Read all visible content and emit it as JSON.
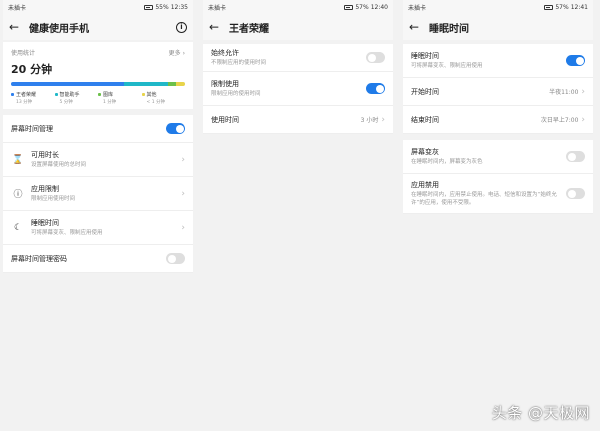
{
  "status": {
    "carrier": "未插卡",
    "s1": {
      "battery": "55%",
      "time": "12:35"
    },
    "s2": {
      "battery": "57%",
      "time": "12:40"
    },
    "s3": {
      "battery": "57%",
      "time": "12:41"
    }
  },
  "screen1": {
    "title": "健康使用手机",
    "usage": {
      "label": "使用统计",
      "more": "更多",
      "total": "20 分钟",
      "legend": [
        {
          "name": "王者荣耀",
          "value": "13 分钟",
          "minutes": 13,
          "color": "#2f80ed"
        },
        {
          "name": "智能助手",
          "value": "5 分钟",
          "minutes": 5,
          "color": "#20b8c8"
        },
        {
          "name": "图库",
          "value": "1 分钟",
          "minutes": 1,
          "color": "#6cc04a"
        },
        {
          "name": "其他",
          "value": "< 1 分钟",
          "minutes": 1,
          "color": "#e8d44a"
        }
      ]
    },
    "manage_label": "屏幕时间管理",
    "items": [
      {
        "title": "可用时长",
        "subtitle": "设置屏幕使用的总时间"
      },
      {
        "title": "应用限制",
        "subtitle": "限制应用使用时间"
      },
      {
        "title": "睡眠时间",
        "subtitle": "可将屏幕变灰、限制应用使用"
      }
    ],
    "password_label": "屏幕时间管理密码"
  },
  "screen2": {
    "title": "王者荣耀",
    "always_allow": {
      "title": "始终允许",
      "subtitle": "不限制应用的使用时间"
    },
    "limit": {
      "title": "限制使用",
      "subtitle": "限制应用的使用时间"
    },
    "usage_time": {
      "title": "使用时间",
      "value": "3 小时"
    }
  },
  "screen3": {
    "title": "睡眠时间",
    "sleep": {
      "title": "睡眠时间",
      "subtitle": "可将屏幕变灰、限制应用使用"
    },
    "start": {
      "title": "开始时间",
      "value": "半夜11:00"
    },
    "end": {
      "title": "结束时间",
      "value": "次日早上7:00"
    },
    "gray": {
      "title": "屏幕变灰",
      "subtitle": "在睡眠时间内，屏幕变为灰色"
    },
    "ban": {
      "title": "应用禁用",
      "subtitle": "在睡眠时间内，应用禁止使用。电话、短信和设置为“始终允许”的应用，使用不受限。"
    }
  },
  "watermark": "头条 @天极网",
  "icons": {
    "back": "arrow-left-icon",
    "info": "info-icon",
    "hourglass": "hourglass-icon",
    "limit": "alert-circle-icon",
    "sleep": "moon-icon",
    "chevron": "chevron-right-icon"
  }
}
